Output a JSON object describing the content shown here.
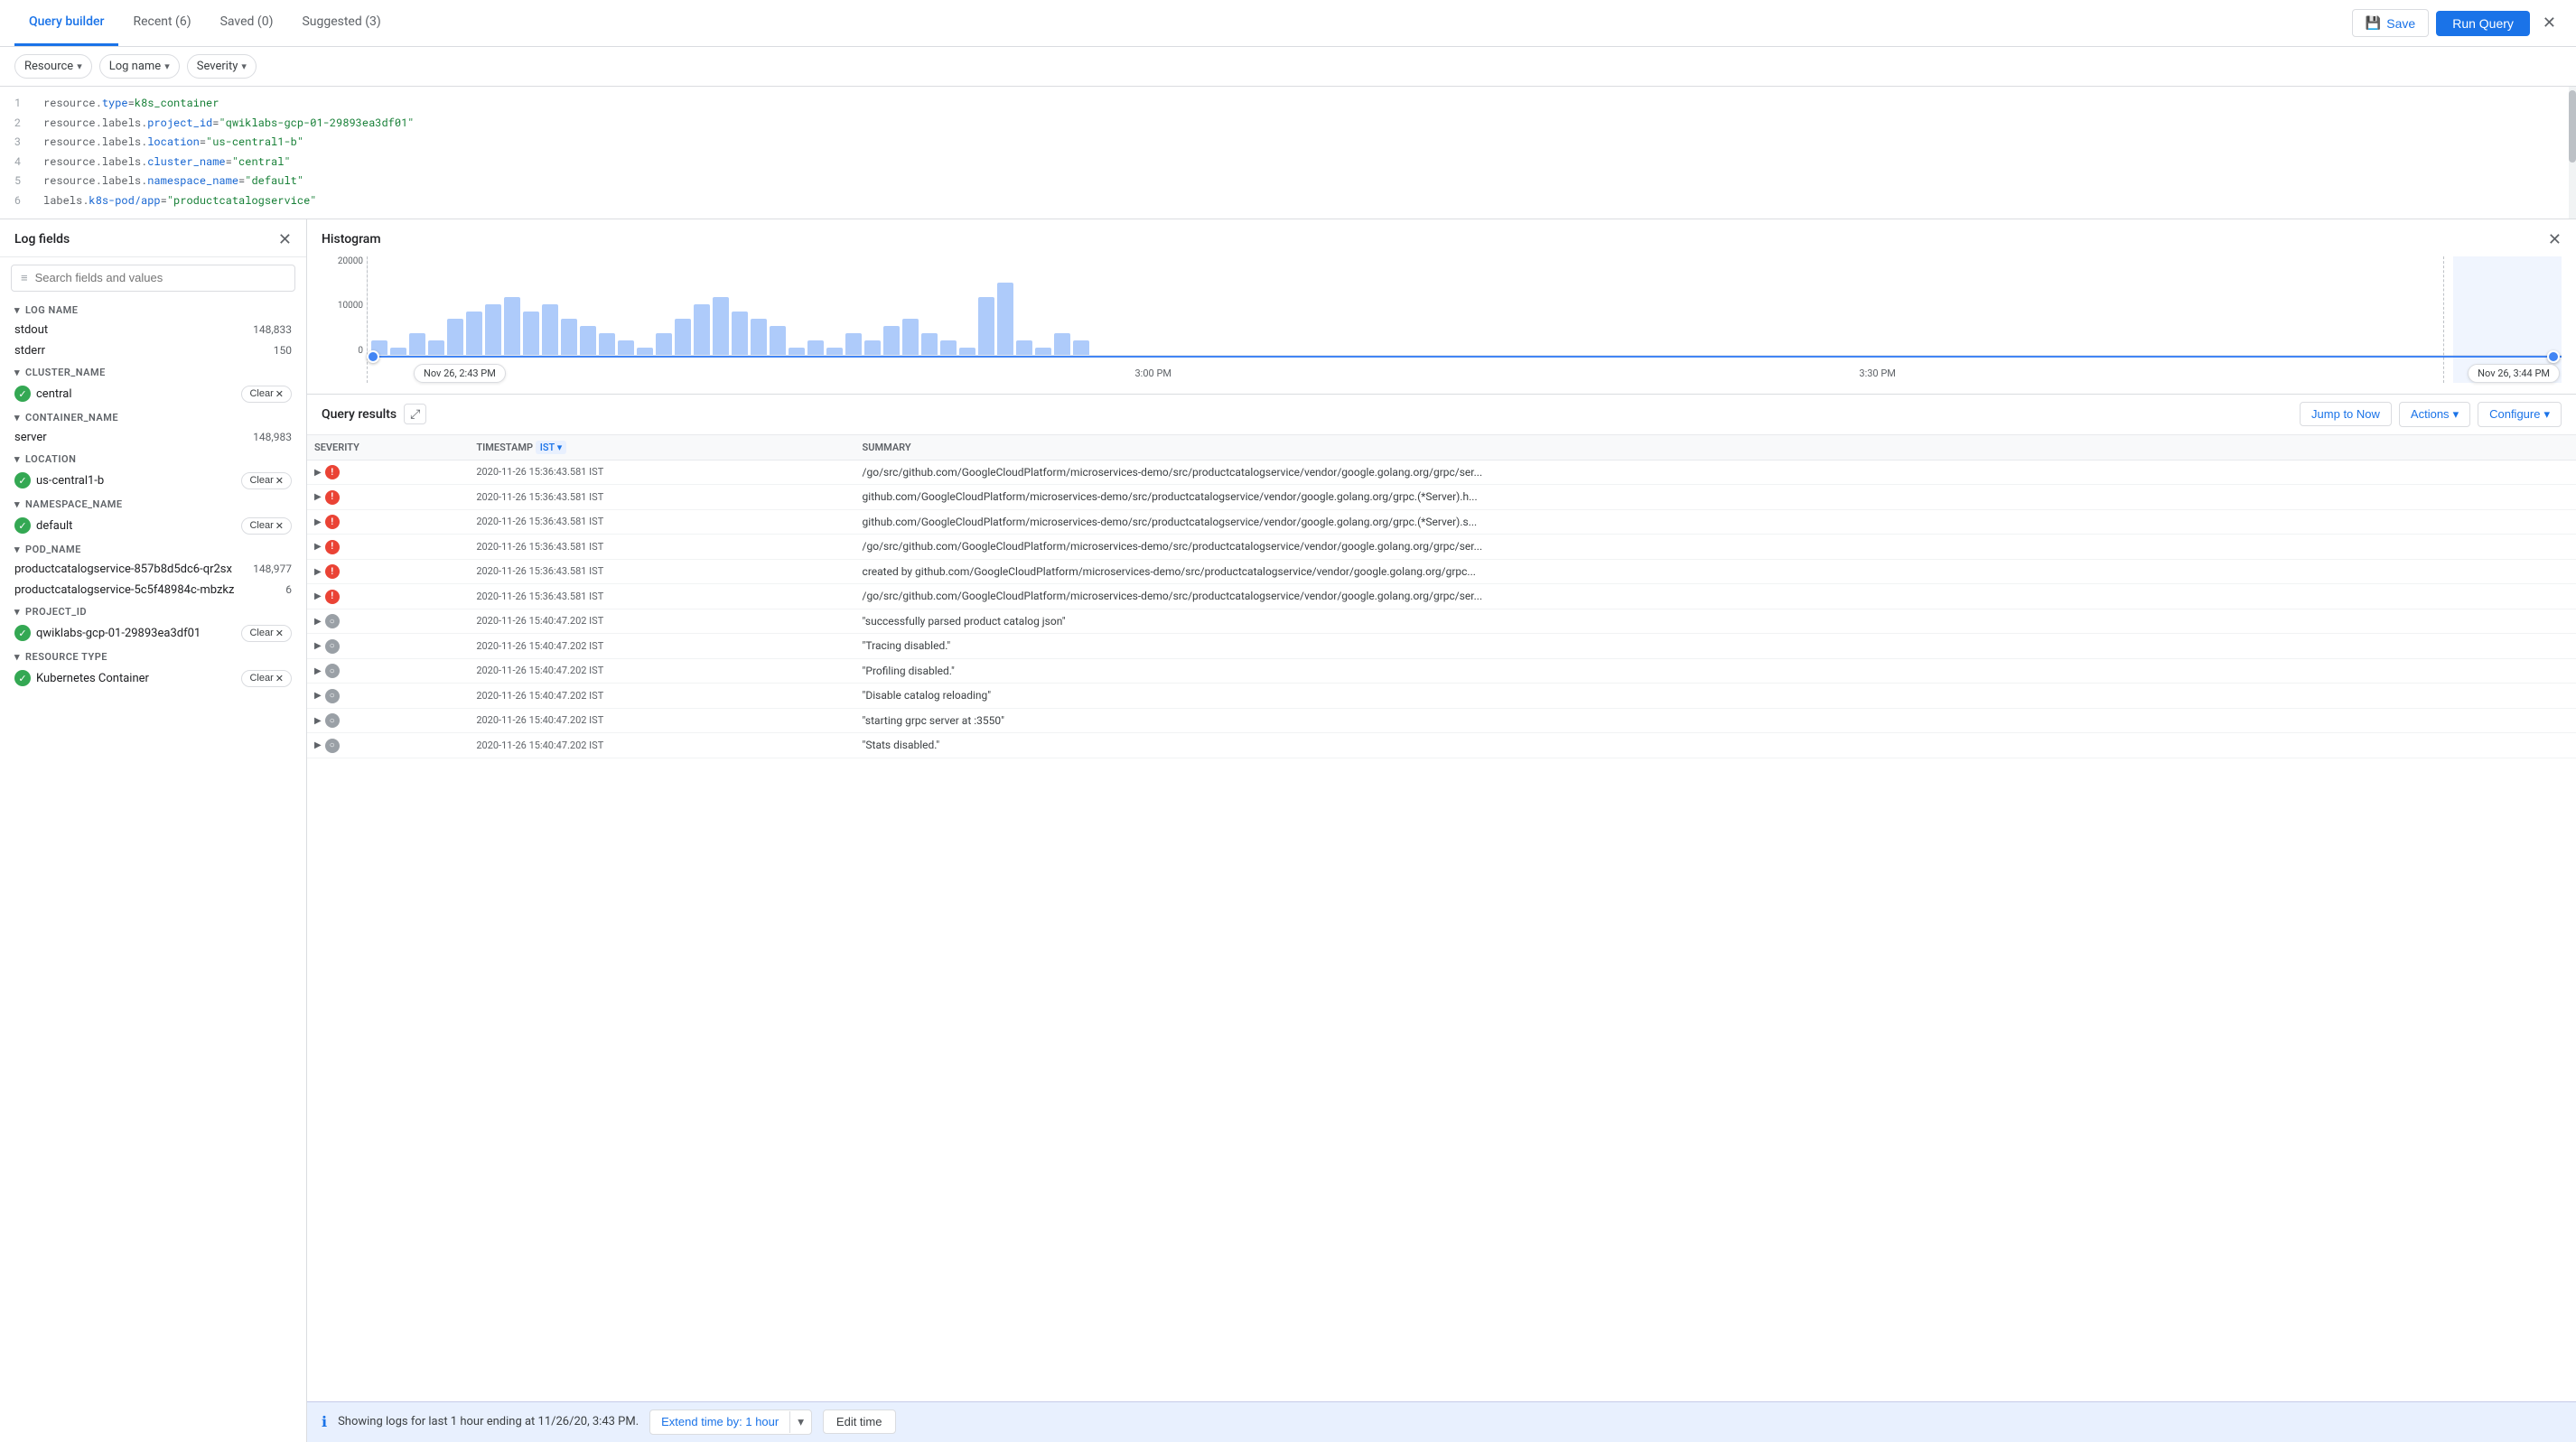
{
  "tabs": [
    {
      "label": "Query builder",
      "active": true
    },
    {
      "label": "Recent (6)",
      "active": false
    },
    {
      "label": "Saved (0)",
      "active": false
    },
    {
      "label": "Suggested (3)",
      "active": false
    }
  ],
  "toolbar": {
    "save_label": "Save",
    "run_label": "Run Query",
    "close_label": "✕"
  },
  "filters": [
    {
      "label": "Resource",
      "id": "resource"
    },
    {
      "label": "Log name",
      "id": "logname"
    },
    {
      "label": "Severity",
      "id": "severity"
    }
  ],
  "query_lines": [
    {
      "num": "1",
      "text": "resource.type=k8s_container"
    },
    {
      "num": "2",
      "text": "resource.labels.project_id=\"qwiklabs-gcp-01-29893ea3df01\""
    },
    {
      "num": "3",
      "text": "resource.labels.location=\"us-central1-b\""
    },
    {
      "num": "4",
      "text": "resource.labels.cluster_name=\"central\""
    },
    {
      "num": "5",
      "text": "resource.labels.namespace_name=\"default\""
    },
    {
      "num": "6",
      "text": "labels.k8s-pod/app=\"productcatalogservice\""
    }
  ],
  "log_fields": {
    "title": "Log fields",
    "search_placeholder": "Search fields and values",
    "sections": [
      {
        "name": "LOG NAME",
        "items": [
          {
            "label": "stdout",
            "count": "148,833",
            "has_check": false,
            "has_clear": false
          },
          {
            "label": "stderr",
            "count": "150",
            "has_check": false,
            "has_clear": false
          }
        ]
      },
      {
        "name": "CLUSTER_NAME",
        "items": [
          {
            "label": "central",
            "count": "",
            "has_check": true,
            "has_clear": true
          }
        ]
      },
      {
        "name": "CONTAINER_NAME",
        "items": [
          {
            "label": "server",
            "count": "148,983",
            "has_check": false,
            "has_clear": false
          }
        ]
      },
      {
        "name": "LOCATION",
        "items": [
          {
            "label": "us-central1-b",
            "count": "",
            "has_check": true,
            "has_clear": true
          }
        ]
      },
      {
        "name": "NAMESPACE_NAME",
        "items": [
          {
            "label": "default",
            "count": "",
            "has_check": true,
            "has_clear": true
          }
        ]
      },
      {
        "name": "POD_NAME",
        "items": [
          {
            "label": "productcatalogservice-857b8d5dc6-qr2sx",
            "count": "148,977",
            "has_check": false,
            "has_clear": false
          },
          {
            "label": "productcatalogservice-5c5f48984c-mbzkz",
            "count": "6",
            "has_check": false,
            "has_clear": false
          }
        ]
      },
      {
        "name": "PROJECT_ID",
        "items": [
          {
            "label": "qwiklabs-gcp-01-29893ea3df01",
            "count": "",
            "has_check": true,
            "has_clear": true
          }
        ]
      },
      {
        "name": "RESOURCE TYPE",
        "items": [
          {
            "label": "Kubernetes Container",
            "count": "",
            "has_check": true,
            "has_clear": true
          }
        ]
      }
    ]
  },
  "histogram": {
    "title": "Histogram",
    "y_labels": [
      "20000",
      "10000",
      "0"
    ],
    "x_labels": [
      "3:00 PM",
      "3:30 PM"
    ],
    "time_start": "Nov 26, 2:43 PM",
    "time_end": "Nov 26, 3:44 PM",
    "bars": [
      2,
      1,
      3,
      2,
      5,
      6,
      7,
      8,
      6,
      7,
      5,
      4,
      3,
      2,
      1,
      3,
      5,
      7,
      8,
      6,
      5,
      4,
      1,
      2,
      1,
      3,
      2,
      4,
      5,
      3,
      2,
      1,
      8,
      10,
      2,
      1,
      3,
      2
    ]
  },
  "query_results": {
    "title": "Query results",
    "jump_to_now": "Jump to Now",
    "actions": "Actions",
    "configure": "Configure",
    "columns": [
      "SEVERITY",
      "TIMESTAMP",
      "IST",
      "SUMMARY"
    ],
    "rows": [
      {
        "sev": "error",
        "timestamp": "2020-11-26 15:36:43.581",
        "tz": "IST",
        "summary": "/go/src/github.com/GoogleCloudPlatform/microservices-demo/src/productcatalogservice/vendor/google.golang.org/grpc/ser..."
      },
      {
        "sev": "error",
        "timestamp": "2020-11-26 15:36:43.581",
        "tz": "IST",
        "summary": "github.com/GoogleCloudPlatform/microservices-demo/src/productcatalogservice/vendor/google.golang.org/grpc.(*Server).h..."
      },
      {
        "sev": "error",
        "timestamp": "2020-11-26 15:36:43.581",
        "tz": "IST",
        "summary": "github.com/GoogleCloudPlatform/microservices-demo/src/productcatalogservice/vendor/google.golang.org/grpc.(*Server).s..."
      },
      {
        "sev": "error",
        "timestamp": "2020-11-26 15:36:43.581",
        "tz": "IST",
        "summary": "/go/src/github.com/GoogleCloudPlatform/microservices-demo/src/productcatalogservice/vendor/google.golang.org/grpc/ser..."
      },
      {
        "sev": "error",
        "timestamp": "2020-11-26 15:36:43.581",
        "tz": "IST",
        "summary": "created by github.com/GoogleCloudPlatform/microservices-demo/src/productcatalogservice/vendor/google.golang.org/grpc..."
      },
      {
        "sev": "error",
        "timestamp": "2020-11-26 15:36:43.581",
        "tz": "IST",
        "summary": "/go/src/github.com/GoogleCloudPlatform/microservices-demo/src/productcatalogservice/vendor/google.golang.org/grpc/ser..."
      },
      {
        "sev": "default",
        "timestamp": "2020-11-26 15:40:47.202",
        "tz": "IST",
        "summary": "\"successfully parsed product catalog json\""
      },
      {
        "sev": "default",
        "timestamp": "2020-11-26 15:40:47.202",
        "tz": "IST",
        "summary": "\"Tracing disabled.\""
      },
      {
        "sev": "default",
        "timestamp": "2020-11-26 15:40:47.202",
        "tz": "IST",
        "summary": "\"Profiling disabled.\""
      },
      {
        "sev": "default",
        "timestamp": "2020-11-26 15:40:47.202",
        "tz": "IST",
        "summary": "\"Disable catalog reloading\""
      },
      {
        "sev": "default",
        "timestamp": "2020-11-26 15:40:47.202",
        "tz": "IST",
        "summary": "\"starting grpc server at :3550\""
      },
      {
        "sev": "default",
        "timestamp": "2020-11-26 15:40:47.202",
        "tz": "IST",
        "summary": "\"Stats disabled.\""
      }
    ]
  },
  "bottom_bar": {
    "message": "Showing logs for last 1 hour ending at 11/26/20, 3:43 PM.",
    "extend_label": "Extend time by: 1 hour",
    "edit_label": "Edit time"
  }
}
